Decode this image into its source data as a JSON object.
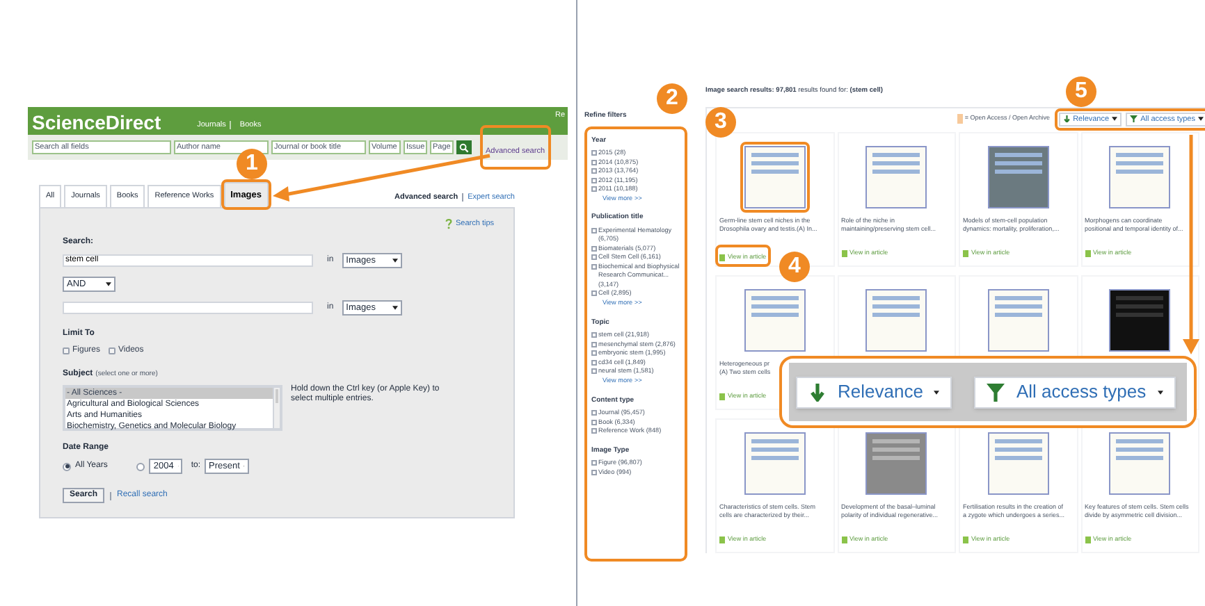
{
  "left_panel": {
    "header": {
      "logo": "ScienceDirect",
      "nav": [
        "Journals",
        "Books"
      ],
      "cut_text": "Re"
    },
    "quick_search": {
      "fields": [
        {
          "placeholder": "Search all fields"
        },
        {
          "placeholder": "Author name"
        },
        {
          "placeholder": "Journal or book title"
        },
        {
          "placeholder": "Volume"
        },
        {
          "placeholder": "Issue"
        },
        {
          "placeholder": "Page"
        }
      ],
      "advanced_link": "Advanced search"
    },
    "tabs": [
      {
        "label": "All",
        "selected": false
      },
      {
        "label": "Journals",
        "selected": false
      },
      {
        "label": "Books",
        "selected": false
      },
      {
        "label": "Reference Works",
        "selected": false
      },
      {
        "label": "Images",
        "selected": true
      }
    ],
    "search_modes": [
      {
        "label": "Advanced search",
        "selected": true
      },
      {
        "label": "Expert search",
        "selected": false
      }
    ],
    "form": {
      "search_tips": "Search tips",
      "search_label": "Search:",
      "terms": [
        {
          "value": "stem cell",
          "in_label": "in",
          "field": "Images"
        },
        {
          "in_label": "in",
          "field": "Images"
        }
      ],
      "operator": "AND",
      "limit_label": "Limit To",
      "limit_options": [
        {
          "label": "Figures",
          "checked": false
        },
        {
          "label": "Videos",
          "checked": false
        }
      ],
      "subject_label": "Subject",
      "subject_hint": "(select one or more)",
      "subjects": [
        {
          "label": "- All Sciences -",
          "selected": true
        },
        {
          "label": "Agricultural and Biological Sciences",
          "selected": false
        },
        {
          "label": "Arts and Humanities",
          "selected": false
        },
        {
          "label": "Biochemistry, Genetics and Molecular Biology",
          "selected": false
        }
      ],
      "subject_note": "Hold down the Ctrl key (or Apple Key) to select multiple entries.",
      "date_label": "Date Range",
      "date_options": [
        {
          "label": "All Years",
          "selected": true
        },
        {
          "selected": false
        }
      ],
      "from_year": "2004",
      "to_label": "to:",
      "to_value": "Present",
      "search_button": "Search",
      "recall_link": "Recall search"
    }
  },
  "right_panel": {
    "summary": "**Image search results: 97,801** results found for: **(stem cell)**",
    "filters": {
      "title": "Refine filters",
      "groups": [
        {
          "title": "Year",
          "options": [
            {
              "label": "2015 (28)",
              "checked": false
            },
            {
              "label": "2014 (10,875)",
              "checked": false
            },
            {
              "label": "2013 (13,764)",
              "checked": false
            },
            {
              "label": "2012 (11,195)",
              "checked": false
            },
            {
              "label": "2011 (10,188)",
              "checked": false
            }
          ],
          "more": "View more >>"
        },
        {
          "title": "Publication title",
          "options": [
            {
              "label": "Experimental Hematology (6,705)",
              "checked": false
            },
            {
              "label": "Biomaterials (5,077)",
              "checked": false
            },
            {
              "label": "Cell Stem Cell (6,161)",
              "checked": false
            },
            {
              "label": "Biochemical and Biophysical Research Communicat... (3,147)",
              "checked": false
            },
            {
              "label": "Cell (2,895)",
              "checked": false
            }
          ],
          "more": "View more >>"
        },
        {
          "title": "Topic",
          "options": [
            {
              "label": "stem cell (21,918)",
              "checked": false
            },
            {
              "label": "mesenchymal stem (2,876)",
              "checked": false
            },
            {
              "label": "embryonic stem (1,995)",
              "checked": false
            },
            {
              "label": "cd34 cell (1,849)",
              "checked": false
            },
            {
              "label": "neural stem (1,581)",
              "checked": false
            }
          ],
          "more": "View more >>"
        },
        {
          "title": "Content type",
          "options": [
            {
              "label": "Journal (95,457)",
              "checked": false
            },
            {
              "label": "Book (6,334)",
              "checked": false
            },
            {
              "label": "Reference Work (848)",
              "checked": false
            }
          ]
        },
        {
          "title": "Image Type",
          "options": [
            {
              "label": "Figure (96,807)",
              "checked": false
            },
            {
              "label": "Video (994)",
              "checked": false
            }
          ]
        }
      ]
    },
    "legend": "= Open Access / Open Archive",
    "sort": "Relevance",
    "access": "All access types",
    "results": [
      {
        "kind": "diagram",
        "caption": [
          "Germ-line stem cell niches in the",
          "Drosophila ovary and testis.(A) In..."
        ],
        "link": "View in article"
      },
      {
        "kind": "diagram",
        "caption": [
          "Role of the niche in",
          "maintaining/preserving stem cell..."
        ],
        "link": "View in article"
      },
      {
        "kind": "dark_diagram",
        "caption": [
          "Models of stem-cell population",
          "dynamics: mortality, proliferation,..."
        ],
        "link": "View in article"
      },
      {
        "kind": "diagram",
        "caption": [
          "Morphogens can coordinate",
          "positional and temporal identity of..."
        ],
        "link": "View in article"
      },
      {
        "kind": "diagram",
        "caption": [
          "Heterogeneous pr",
          "(A) Two stem cells"
        ],
        "link": "View in article"
      },
      {
        "kind": "diagram"
      },
      {
        "kind": "diagram"
      },
      {
        "kind": "micrograph"
      },
      {
        "kind": "diagram",
        "caption": [
          "Characteristics of stem cells. Stem",
          "cells are characterized by their..."
        ],
        "link": "View in article"
      },
      {
        "kind": "photo",
        "caption": [
          "Development of the basal–luminal",
          "polarity of individual regenerative..."
        ],
        "link": "View in article"
      },
      {
        "kind": "diagram",
        "caption": [
          "Fertilisation results in the creation of",
          "a zygote which undergoes a series..."
        ],
        "link": "View in article"
      },
      {
        "kind": "diagram",
        "caption": [
          "Key features of stem cells. Stem cells",
          "divide by asymmetric cell division..."
        ],
        "link": "View in article"
      }
    ],
    "zoom_inset": {
      "sort": "Relevance",
      "access": "All access types"
    }
  },
  "callouts": [
    "1",
    "2",
    "3",
    "4",
    "5"
  ]
}
